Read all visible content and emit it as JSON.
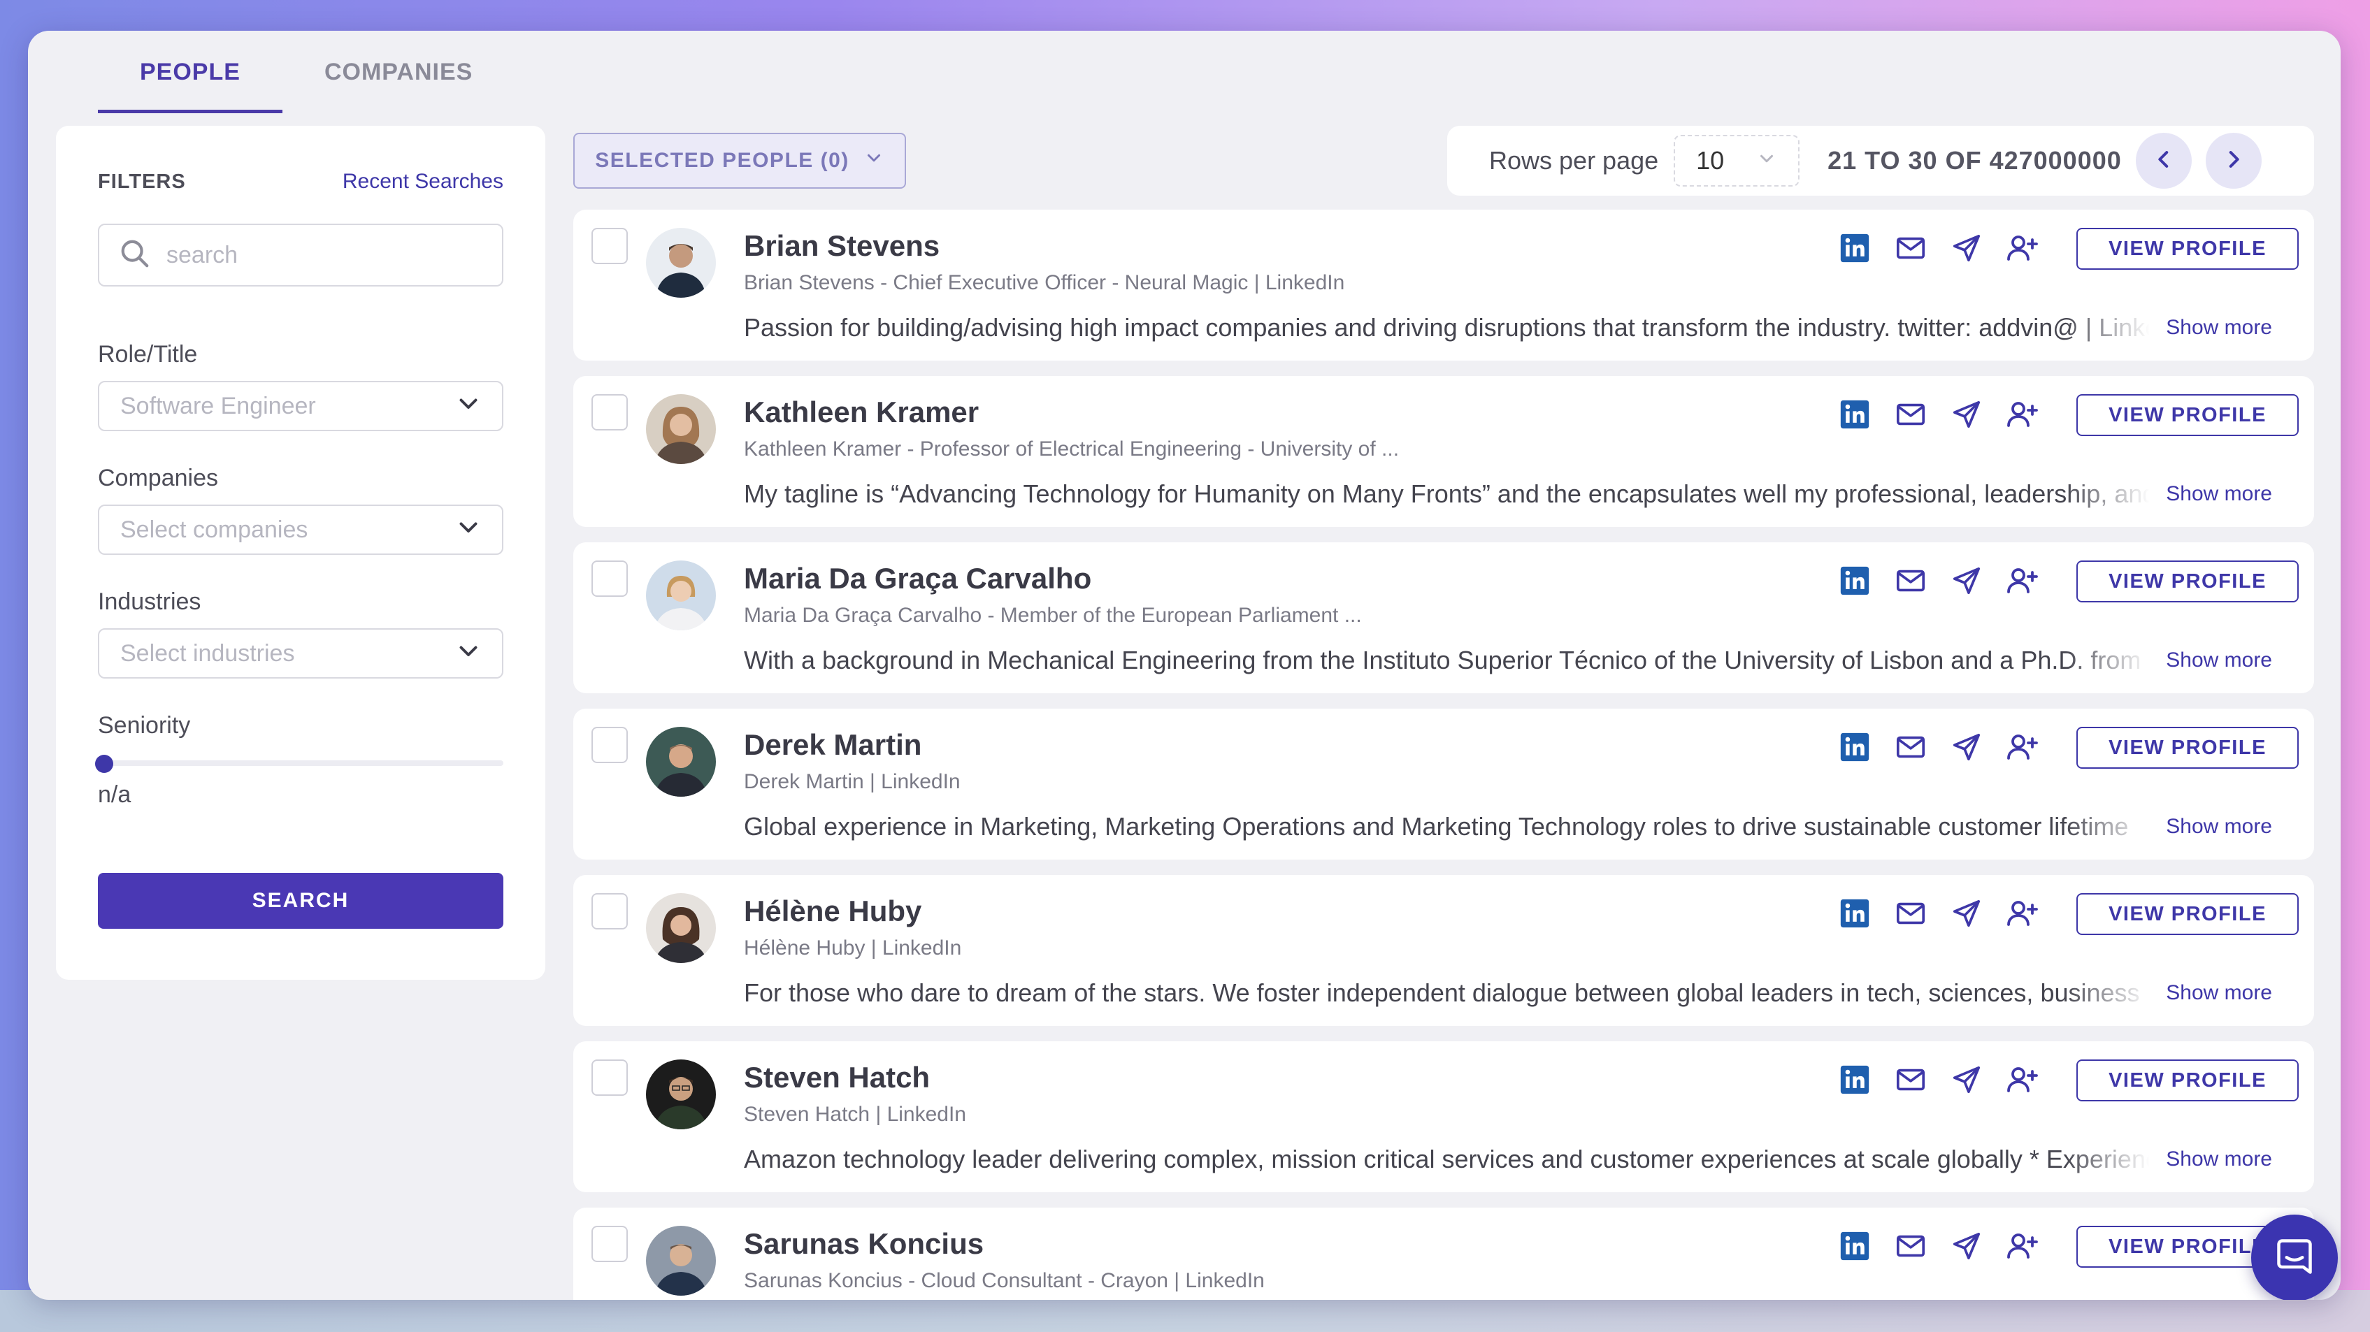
{
  "tabs": [
    {
      "label": "PEOPLE",
      "active": true
    },
    {
      "label": "COMPANIES",
      "active": false
    }
  ],
  "filters": {
    "title": "FILTERS",
    "recent_searches": "Recent Searches",
    "search_placeholder": "search",
    "role_label": "Role/Title",
    "role_value": "Software Engineer",
    "companies_label": "Companies",
    "companies_placeholder": "Select companies",
    "industries_label": "Industries",
    "industries_placeholder": "Select industries",
    "seniority_label": "Seniority",
    "seniority_value": "n/a",
    "search_button": "SEARCH"
  },
  "toolbar": {
    "selected_label": "SELECTED PEOPLE (0)",
    "rows_label": "Rows per page",
    "rows_value": "10",
    "range": "21 TO 30 OF 427000000"
  },
  "people": [
    {
      "name": "Brian Stevens",
      "subtitle": "Brian Stevens - Chief Executive Officer - Neural Magic | LinkedIn",
      "bio": "Passion for building/advising high impact companies and driving disruptions that transform the industry. twitter: addvin@ | LinkedIn",
      "show_more": "Show more",
      "view_profile": "VIEW PROFILE"
    },
    {
      "name": "Kathleen Kramer",
      "subtitle": "Kathleen Kramer - Professor of Electrical Engineering - University of ...",
      "bio": "My tagline is “Advancing Technology for Humanity on Many Fronts” and the encapsulates well my professional, leadership, and",
      "show_more": "Show more",
      "view_profile": "VIEW PROFILE"
    },
    {
      "name": "Maria Da Graça Carvalho",
      "subtitle": "Maria Da Graça Carvalho - Member of the European Parliament ...",
      "bio": "With a background in Mechanical Engineering from the Instituto Superior Técnico of the University of Lisbon and a Ph.D. from",
      "show_more": "Show more",
      "view_profile": "VIEW PROFILE"
    },
    {
      "name": "Derek Martin",
      "subtitle": "Derek Martin | LinkedIn",
      "bio": "Global experience in Marketing, Marketing Operations and Marketing Technology roles to drive sustainable customer lifetime",
      "show_more": "Show more",
      "view_profile": "VIEW PROFILE"
    },
    {
      "name": "Hélène Huby",
      "subtitle": "Hélène Huby | LinkedIn",
      "bio": "For those who dare to dream of the stars. We foster independent dialogue between global leaders in tech, sciences, business",
      "show_more": "Show more",
      "view_profile": "VIEW PROFILE"
    },
    {
      "name": "Steven Hatch",
      "subtitle": "Steven Hatch | LinkedIn",
      "bio": "Amazon technology leader delivering complex, mission critical services and customer experiences at scale globally * Experience",
      "show_more": "Show more",
      "view_profile": "VIEW PROFILE"
    },
    {
      "name": "Sarunas Koncius",
      "subtitle": "Sarunas Koncius - Cloud Consultant - Crayon | LinkedIn",
      "bio": "",
      "show_more": "",
      "view_profile": "VIEW PROFILE"
    }
  ],
  "colors": {
    "accent": "#4a38b4",
    "linkedin": "#1f5fae"
  }
}
